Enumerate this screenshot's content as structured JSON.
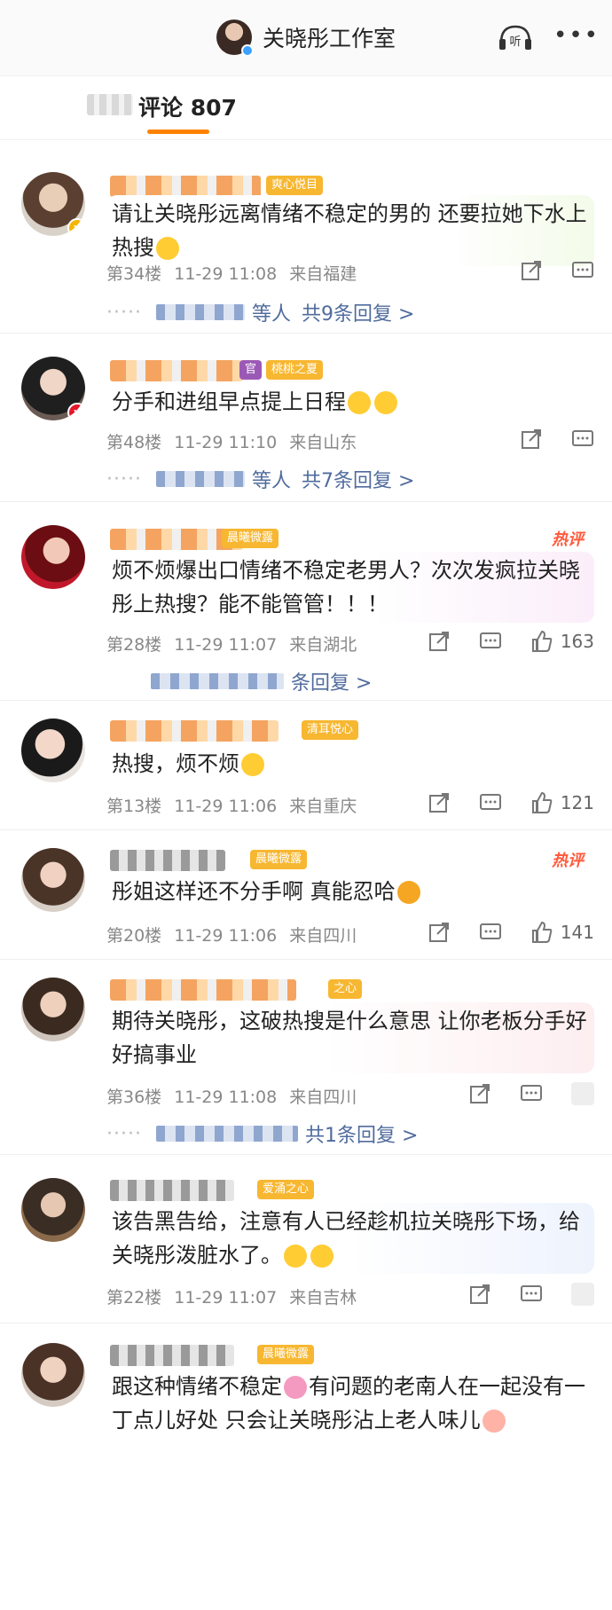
{
  "header": {
    "title": "关晓彤工作室",
    "listen_label": "听",
    "more_label": "•••"
  },
  "tabs": {
    "label": "评论",
    "count": "807"
  },
  "colors": {
    "accent": "#ff8200",
    "reply_link": "#506c9d",
    "hot": "#ff5a3c"
  },
  "comments": [
    {
      "badge": "爽心悦目",
      "text": "请让关晓彤远离情绪不稳定的男的 还要拉她下水上热搜",
      "emoji": "😓",
      "floor": "第34楼",
      "time": "11-29 11:08",
      "location": "来自福建",
      "likes": "",
      "reply_suffix": "等人",
      "reply_link": "共9条回复 >",
      "hot": ""
    },
    {
      "badge": "桃桃之夏",
      "badge_extra": "官",
      "text": "分手和进组早点提上日程",
      "floor": "第48楼",
      "time": "11-29 11:10",
      "location": "来自山东",
      "likes": "",
      "reply_suffix": "等人",
      "reply_link": "共7条回复 >",
      "hot": ""
    },
    {
      "badge": "晨曦微露",
      "text": "烦不烦爆出口情绪不稳定老男人？次次发疯拉关晓彤上热搜？能不能管管！！！",
      "floor": "第28楼",
      "time": "11-29 11:07",
      "location": "来自湖北",
      "likes": "163",
      "reply_suffix": "",
      "reply_link": "条回复 >",
      "hot": "热评"
    },
    {
      "badge": "清耳悦心",
      "text": "热搜，烦不烦",
      "floor": "第13楼",
      "time": "11-29 11:06",
      "location": "来自重庆",
      "likes": "121",
      "reply_suffix": "",
      "reply_link": "",
      "hot": ""
    },
    {
      "badge": "晨曦微露",
      "text": "彤姐这样还不分手啊 真能忍哈",
      "floor": "第20楼",
      "time": "11-29 11:06",
      "location": "来自四川",
      "likes": "141",
      "reply_suffix": "",
      "reply_link": "",
      "hot": "热评"
    },
    {
      "badge": "之心",
      "text": "期待关晓彤，这破热搜是什么意思 让你老板分手好好搞事业",
      "floor": "第36楼",
      "time": "11-29 11:08",
      "location": "来自四川",
      "likes": "",
      "reply_suffix": "",
      "reply_link": "共1条回复 >",
      "hot": ""
    },
    {
      "badge": "爱涌之心",
      "text": "该告黑告给，注意有人已经趁机拉关晓彤下场，给关晓彤泼脏水了。",
      "floor": "第22楼",
      "time": "11-29 11:07",
      "location": "来自吉林",
      "likes": "",
      "reply_suffix": "",
      "reply_link": "",
      "hot": ""
    },
    {
      "badge": "晨曦微露",
      "text_a": "跟这种情绪不稳定",
      "text_b": "有问题的老南人在一起没有一丁点儿好处 只会让关晓彤沾上老人味儿",
      "floor": "",
      "time": "",
      "location": "",
      "likes": "",
      "reply_suffix": "",
      "reply_link": "",
      "hot": ""
    }
  ]
}
